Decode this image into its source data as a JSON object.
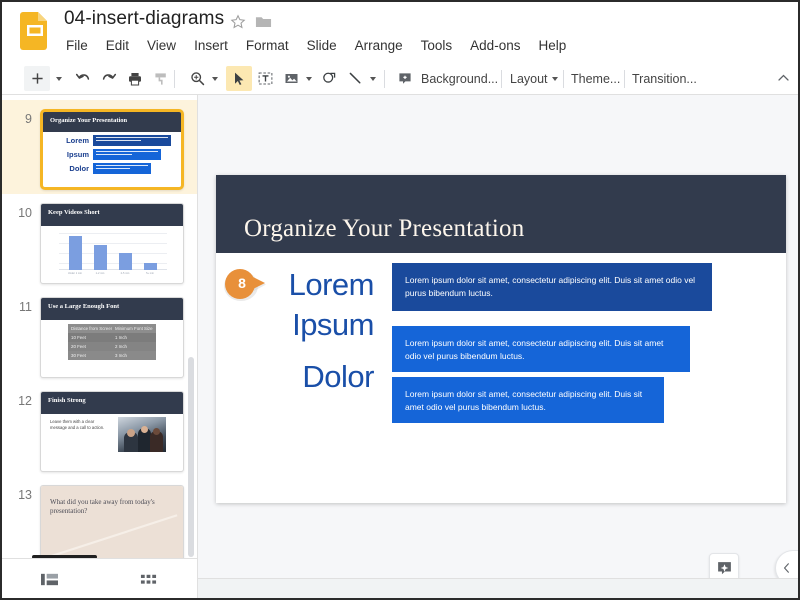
{
  "window": {
    "app_name": "Google Slides",
    "logo_icon": "slides-logo-icon"
  },
  "header": {
    "doc_title": "04-insert-diagrams",
    "star_icon": "star-icon",
    "folder_icon": "folder-icon",
    "menu": [
      {
        "label": "File"
      },
      {
        "label": "Edit"
      },
      {
        "label": "View"
      },
      {
        "label": "Insert"
      },
      {
        "label": "Format"
      },
      {
        "label": "Slide"
      },
      {
        "label": "Arrange"
      },
      {
        "label": "Tools"
      },
      {
        "label": "Add-ons"
      },
      {
        "label": "Help"
      }
    ]
  },
  "toolbar": {
    "icons": [
      {
        "name": "new-slide-icon"
      },
      {
        "name": "new-slide-dropdown-caret"
      },
      {
        "name": "undo-icon"
      },
      {
        "name": "redo-icon"
      },
      {
        "name": "print-icon"
      },
      {
        "name": "paint-format-icon"
      },
      {
        "name": "zoom-icon"
      },
      {
        "name": "zoom-dropdown-caret"
      },
      {
        "name": "select-cursor-icon"
      },
      {
        "name": "text-box-icon"
      },
      {
        "name": "insert-image-icon"
      },
      {
        "name": "image-dropdown-caret"
      },
      {
        "name": "shape-icon"
      },
      {
        "name": "line-icon"
      },
      {
        "name": "line-dropdown-caret"
      },
      {
        "name": "add-comment-icon"
      }
    ],
    "background_label": "Background...",
    "layout_label": "Layout",
    "theme_label": "Theme...",
    "transition_label": "Transition...",
    "collapse_icon": "chevron-up-icon"
  },
  "filmstrip": {
    "selected_slide": 9,
    "slides": [
      {
        "number": "9",
        "title": "Organize Your Presentation",
        "type": "diagram",
        "selected": true,
        "labels": [
          "Lorem",
          "Ipsum",
          "Dolor"
        ]
      },
      {
        "number": "10",
        "title": "Keep Videos Short",
        "type": "chart"
      },
      {
        "number": "11",
        "title": "Use a Large Enough Font",
        "type": "table",
        "table": {
          "headers": [
            "Distance from Screen",
            "Minimum Font Size"
          ],
          "rows": [
            [
              "10 Feet",
              "1 Inch"
            ],
            [
              "20 Feet",
              "2 Inch"
            ],
            [
              "30 Feet",
              "3 Inch"
            ]
          ]
        }
      },
      {
        "number": "12",
        "title": "Finish Strong",
        "type": "photo",
        "body": "Leave them with a clear message and a call to action."
      },
      {
        "number": "13",
        "title": "What did you take away from today's presentation?",
        "type": "question"
      }
    ],
    "footer": {
      "filmstrip_view_icon": "filmstrip-view-icon",
      "grid_view_icon": "grid-view-icon"
    }
  },
  "slide": {
    "title": "Organize Your Presentation",
    "rows": [
      {
        "label": "Lorem",
        "text": "Lorem ipsum dolor sit amet, consectetur adipiscing elit. Duis sit amet odio vel purus bibendum luctus."
      },
      {
        "label": "Ipsum",
        "text": "Lorem ipsum dolor sit amet, consectetur adipiscing elit. Duis sit amet odio vel purus bibendum luctus."
      },
      {
        "label": "Dolor",
        "text": "Lorem ipsum dolor sit amet, consectetur adipiscing elit. Duis sit amet odio vel purus bibendum luctus."
      }
    ],
    "callout_badge": "8"
  },
  "canvas_footer": {
    "explore_icon": "explore-sparkle-icon",
    "panel_toggle_icon": "chevron-left-icon",
    "notes_handle_icon": "notes-drag-handle"
  },
  "chart_data": {
    "type": "bar",
    "title": "Keep Videos Short",
    "categories": [
      "Under 1 min",
      "1-2 min",
      "2-5 min",
      "5+ min"
    ],
    "values": [
      82,
      60,
      41,
      16
    ],
    "xlabel": "",
    "ylabel": "",
    "ylim": [
      0,
      100
    ],
    "grid": true,
    "legend": "none",
    "series_color": "#7b9ee0"
  },
  "colors": {
    "header_navy": "#323b4d",
    "box_dark_blue": "#1a4a9c",
    "box_blue": "#1565d8",
    "label_blue": "#1a4fa8",
    "badge_orange": "#e8903a",
    "selection_yellow": "#f5b624",
    "selection_row_bg": "#fdf3dc",
    "toolbar_active": "#fce8b2",
    "canvas_bg": "#f6f7f9",
    "chart_bar": "#7b9ee0",
    "question_slide_bg": "#ece0d6"
  }
}
